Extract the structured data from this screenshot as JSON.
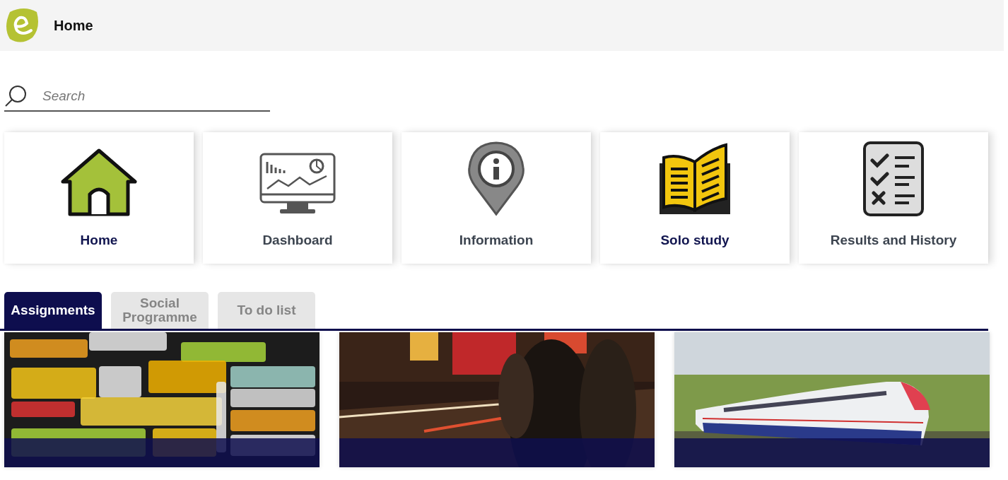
{
  "header": {
    "title": "Home"
  },
  "search": {
    "placeholder": "Search"
  },
  "tiles": [
    {
      "kind": "house",
      "label": "Home",
      "highlighted": true
    },
    {
      "kind": "monitor",
      "label": "Dashboard",
      "highlighted": false
    },
    {
      "kind": "pin",
      "label": "Information",
      "highlighted": false
    },
    {
      "kind": "book",
      "label": "Solo study",
      "highlighted": true
    },
    {
      "kind": "checklist",
      "label": "Results and History",
      "highlighted": false
    }
  ],
  "tabs": [
    {
      "label": "Assignments",
      "selected": true
    },
    {
      "label": "Social Programme",
      "selected": false
    },
    {
      "label": "To do list",
      "selected": false
    }
  ]
}
